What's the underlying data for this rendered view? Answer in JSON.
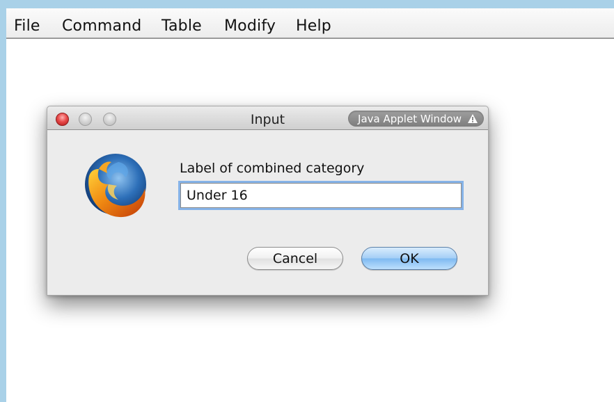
{
  "menubar": {
    "items": [
      "File",
      "Command",
      "Table",
      "Modify",
      "Help"
    ]
  },
  "dialog": {
    "title": "Input",
    "applet_badge": "Java Applet Window",
    "prompt": "Label of combined category",
    "input_value": "Under 16",
    "cancel_label": "Cancel",
    "ok_label": "OK",
    "icons": [
      "close-icon",
      "minimize-icon",
      "zoom-icon",
      "warning-icon",
      "firefox-icon"
    ]
  },
  "colors": {
    "desktop": "#a9d1e8",
    "ok_button": "#8cc4f4",
    "close_button": "#e84b4b",
    "focus_ring": "#86b3e8"
  }
}
